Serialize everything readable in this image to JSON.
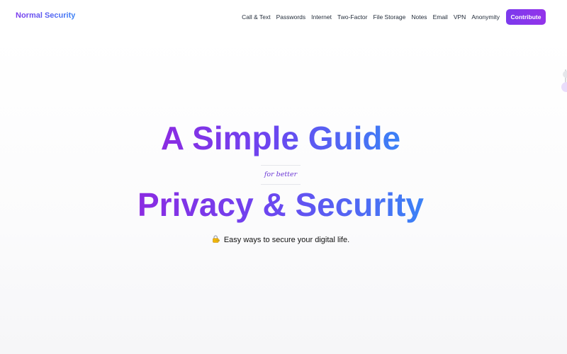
{
  "brand": {
    "name": "Normal Security"
  },
  "nav": {
    "items": [
      {
        "label": "Call & Text"
      },
      {
        "label": "Passwords"
      },
      {
        "label": "Internet"
      },
      {
        "label": "Two-Factor"
      },
      {
        "label": "File Storage"
      },
      {
        "label": "Notes"
      },
      {
        "label": "Email"
      },
      {
        "label": "VPN"
      },
      {
        "label": "Anonymity"
      }
    ],
    "cta_label": "Contribute"
  },
  "hero": {
    "headline_line1": "A Simple Guide",
    "subline": "for better",
    "headline_line2": "Privacy & Security",
    "tagline_icon": "lock-with-key-icon",
    "tagline": "Easy ways to secure your digital life."
  },
  "colors": {
    "gradient_start": "#8b2be2",
    "gradient_end": "#3b82f6",
    "button": "#7c3aed"
  }
}
